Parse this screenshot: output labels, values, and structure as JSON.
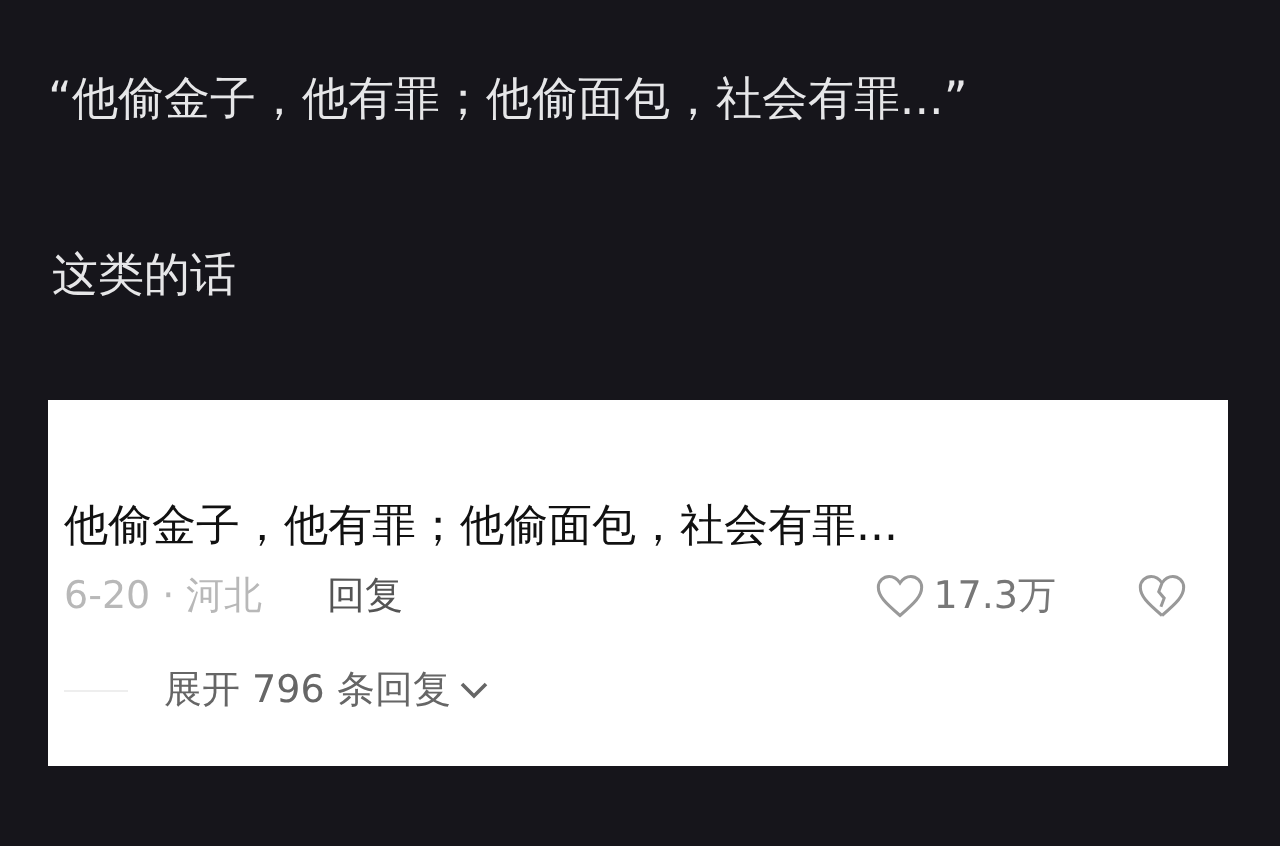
{
  "post": {
    "quote": "“他偷金子，他有罪；他偷面包，社会有罪...”",
    "caption": "这类的话"
  },
  "comment": {
    "text": "他偷金子，他有罪；他偷面包，社会有罪...",
    "date_location": "6-20 · 河北",
    "reply": "回复",
    "likes": "17.3万",
    "liked": false,
    "expand": "展开 796 条回复"
  }
}
